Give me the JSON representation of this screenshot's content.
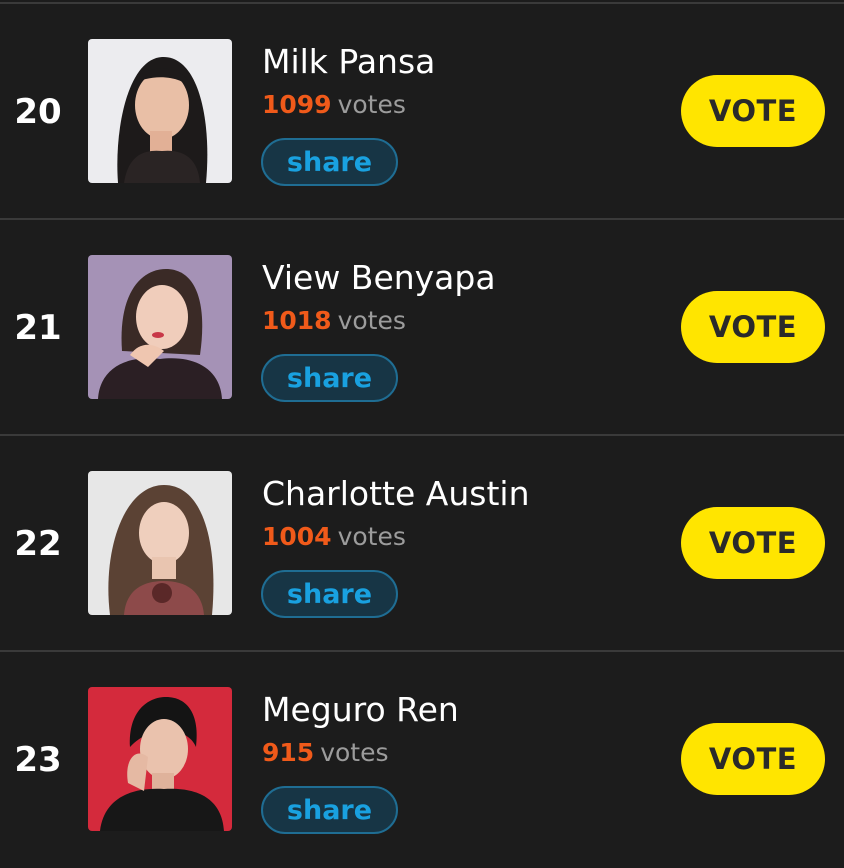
{
  "entries": [
    {
      "rank": "20",
      "name": "Milk Pansa",
      "vote_count": "1099",
      "votes_label": "votes",
      "share_label": "share",
      "vote_label": "VOTE",
      "photo_bg": "#e9e9ec"
    },
    {
      "rank": "21",
      "name": "View Benyapa",
      "vote_count": "1018",
      "votes_label": "votes",
      "share_label": "share",
      "vote_label": "VOTE",
      "photo_bg": "#a48fb4"
    },
    {
      "rank": "22",
      "name": "Charlotte Austin",
      "vote_count": "1004",
      "votes_label": "votes",
      "share_label": "share",
      "vote_label": "VOTE",
      "photo_bg": "#e6e6e6"
    },
    {
      "rank": "23",
      "name": "Meguro Ren",
      "vote_count": "915",
      "votes_label": "votes",
      "share_label": "share",
      "vote_label": "VOTE",
      "photo_bg": "#d42a3c"
    }
  ],
  "colors": {
    "background": "#1c1c1c",
    "vote_count": "#f05a1a",
    "vote_button": "#ffe500",
    "share_text": "#19a1e0"
  }
}
